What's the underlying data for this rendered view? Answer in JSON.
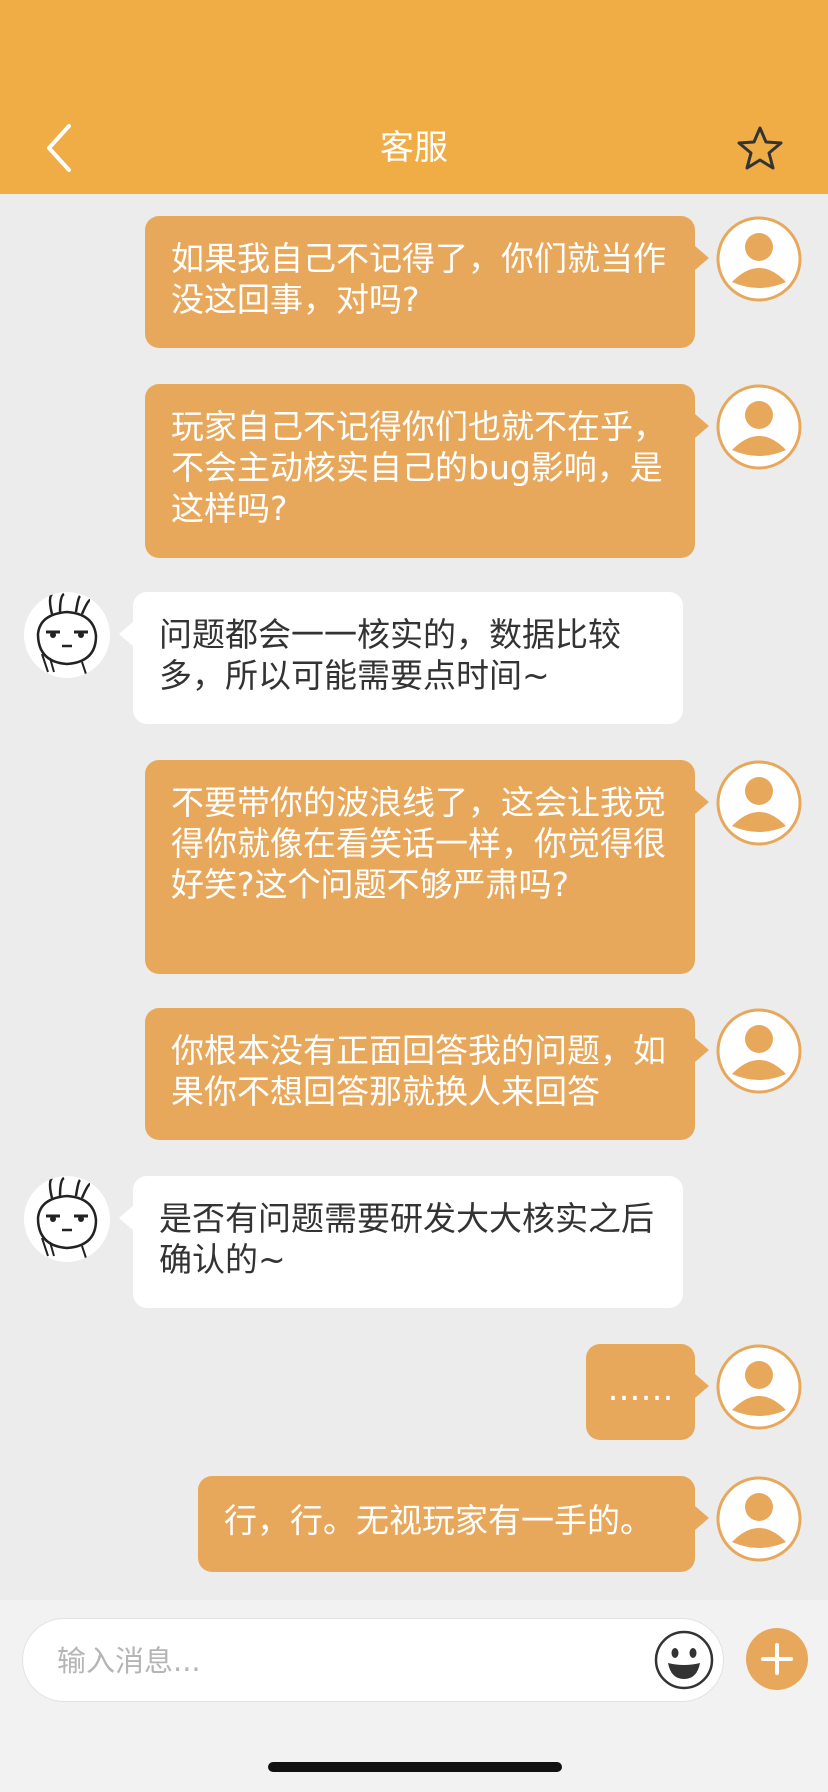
{
  "header": {
    "title": "客服",
    "back_icon": "chevron-left-icon",
    "favorite_icon": "star-outline-icon",
    "background_color": "#f0ac45"
  },
  "messages": [
    {
      "side": "right",
      "text": "如果我自己不记得了，你们就当作没这回事，对吗?"
    },
    {
      "side": "right",
      "text": "玩家自己不记得你们也就不在乎，不会主动核实自己的bug影响，是这样吗?"
    },
    {
      "side": "left",
      "text": "问题都会一一核实的，数据比较多，所以可能需要点时间~"
    },
    {
      "side": "right",
      "text": "不要带你的波浪线了，这会让我觉得你就像在看笑话一样，你觉得很好笑?这个问题不够严肃吗?"
    },
    {
      "side": "right",
      "text": "你根本没有正面回答我的问题，如果你不想回答那就换人来回答"
    },
    {
      "side": "left",
      "text": "是否有问题需要研发大大核实之后确认的~"
    },
    {
      "side": "right",
      "text": "……"
    },
    {
      "side": "right",
      "text": "行，行。无视玩家有一手的。"
    }
  ],
  "input": {
    "placeholder": "输入消息...",
    "emoji_icon": "emoji-smile-icon",
    "plus_icon": "plus-icon"
  },
  "colors": {
    "accent": "#e8a85c",
    "chat_background": "#ececec",
    "agent_bubble": "#ffffff"
  }
}
